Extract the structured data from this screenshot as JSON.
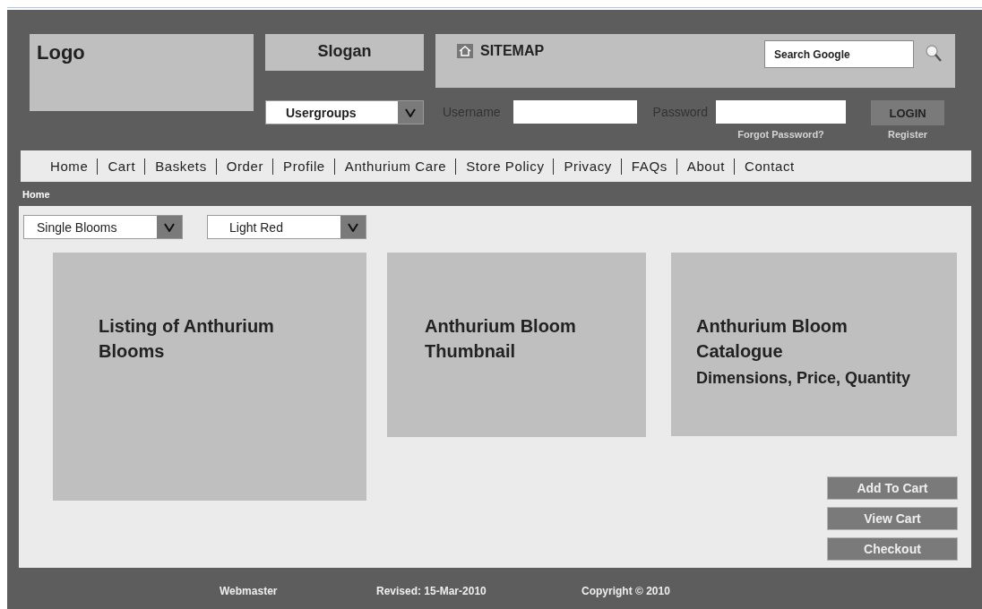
{
  "header": {
    "logo": "Logo",
    "slogan": "Slogan",
    "sitemap": "SITEMAP",
    "search": {
      "placeholder": "Search Google"
    },
    "usergroups": {
      "value": "Usergroups"
    },
    "login": {
      "username_label": "Username",
      "password_label": "Password",
      "button": "LOGIN",
      "forgot": "Forgot Password?",
      "register": "Register"
    }
  },
  "nav": [
    "Home",
    "Cart",
    "Baskets",
    "Order",
    "Profile",
    "Anthurium Care",
    "Store Policy",
    "Privacy",
    "FAQs",
    "About",
    "Contact"
  ],
  "breadcrumb": "Home",
  "filters": [
    {
      "value": "Single Blooms"
    },
    {
      "value": "Light Red"
    }
  ],
  "panels": [
    {
      "title": "Listing of Anthurium Blooms"
    },
    {
      "title": "Anthurium Bloom Thumbnail"
    },
    {
      "title": "Anthurium Bloom Catalogue",
      "subtitle": "Dimensions, Price, Quantity"
    }
  ],
  "buttons": [
    "Add To Cart",
    "View Cart",
    "Checkout"
  ],
  "footer": [
    "Webmaster",
    "Revised: 15-Mar-2010",
    "Copyright © 2010"
  ]
}
